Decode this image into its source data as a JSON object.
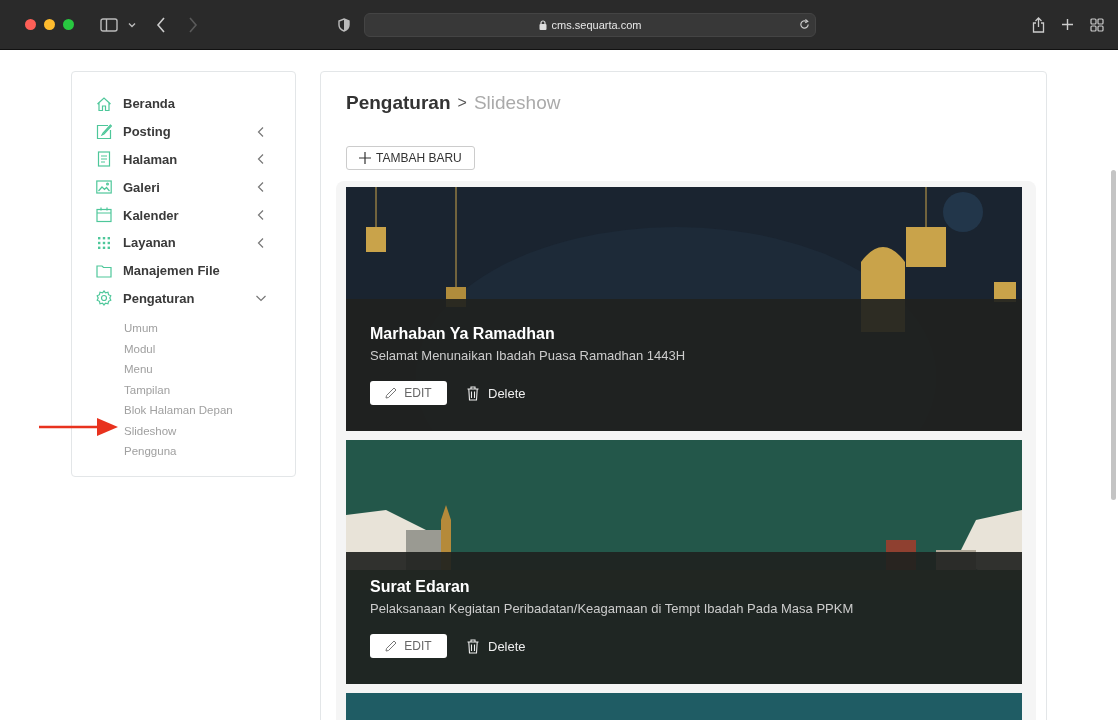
{
  "browser": {
    "url": "cms.sequarta.com",
    "forward_enabled": false
  },
  "sidebar": {
    "items": [
      {
        "label": "Beranda",
        "kind": "link"
      },
      {
        "label": "Posting",
        "kind": "menu",
        "expanded": false
      },
      {
        "label": "Halaman",
        "kind": "menu",
        "expanded": false
      },
      {
        "label": "Galeri",
        "kind": "menu",
        "expanded": false
      },
      {
        "label": "Kalender",
        "kind": "menu",
        "expanded": false
      },
      {
        "label": "Layanan",
        "kind": "menu",
        "expanded": false
      },
      {
        "label": "Manajemen File",
        "kind": "link"
      },
      {
        "label": "Pengaturan",
        "kind": "menu",
        "expanded": true,
        "children": [
          {
            "label": "Umum"
          },
          {
            "label": "Modul"
          },
          {
            "label": "Menu"
          },
          {
            "label": "Tampilan"
          },
          {
            "label": "Blok Halaman Depan"
          },
          {
            "label": "Slideshow"
          },
          {
            "label": "Pengguna"
          }
        ]
      }
    ]
  },
  "breadcrumb": {
    "parent": "Pengaturan",
    "separator": ">",
    "current": "Slideshow"
  },
  "add_button": "TAMBAH BARU",
  "slides": [
    {
      "title": "Marhaban Ya Ramadhan",
      "subtitle": "Selamat Menunaikan Ibadah Puasa Ramadhan 1443H",
      "edit": "EDIT",
      "delete": "Delete",
      "image": {
        "kind": "picture"
      }
    },
    {
      "title": "Surat Edaran",
      "subtitle": "Pelaksanaan Kegiatan Peribadatan/Keagamaan di Tempt Ibadah Pada Masa PPKM",
      "edit": "EDIT",
      "delete": "Delete",
      "image": {
        "kind": "picture"
      }
    },
    {
      "image": {
        "kind": "picture"
      }
    }
  ]
}
